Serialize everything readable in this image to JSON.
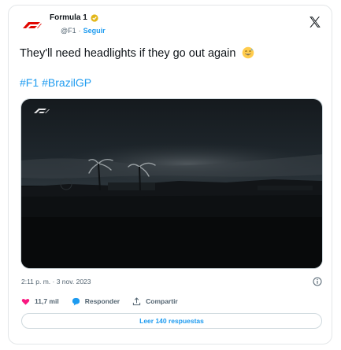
{
  "tweet": {
    "author_name": "Formula 1",
    "author_handle": "@F1",
    "follow_label": "Seguir",
    "text": "They'll need headlights if they go out again",
    "emoji_name": "grinning-sweat-emoji",
    "hashtags": [
      "#F1",
      "#BrazilGP"
    ],
    "timestamp": "2:11 p. m. · 3 nov. 2023",
    "likes_count": "11,7 mil",
    "reply_label": "Responder",
    "share_label": "Compartir",
    "read_replies_label": "Leer 140 respuestas"
  },
  "colors": {
    "accent": "#1d9bf0",
    "brand": "#e10600",
    "like": "#f91880",
    "verified": "#e2b719"
  },
  "icons": {
    "logo": "f1-logo-icon",
    "platform": "x-logo-icon",
    "verified": "verified-badge-icon",
    "info": "info-icon",
    "like": "heart-icon",
    "reply": "reply-bubble-icon",
    "share": "share-icon"
  }
}
